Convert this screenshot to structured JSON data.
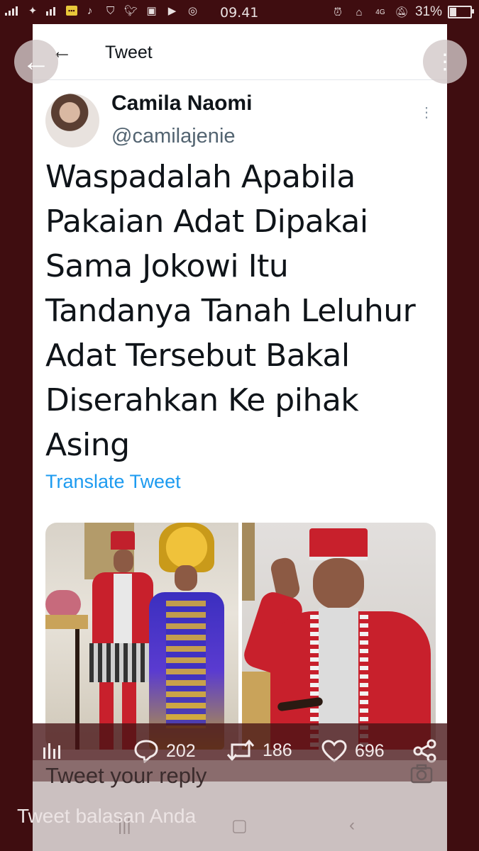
{
  "status_bar": {
    "time": "09.41",
    "battery": "31%",
    "battery_level": 0.31,
    "network": "4G"
  },
  "header": {
    "title": "Tweet"
  },
  "tweet": {
    "author_name": "Camila Naomi",
    "author_handle": "@camilajenie",
    "lines": [
      "Waspadalah Apabila",
      "Pakaian Adat Dipakai",
      "Sama Jokowi Itu",
      "Tandanya Tanah Leluhur",
      "Adat Tersebut Bakal",
      "Diserahkan Ke pihak",
      "Asing"
    ],
    "translate_label": "Translate Tweet"
  },
  "actions": {
    "replies": "202",
    "retweets": "186",
    "likes": "696"
  },
  "reply_box": {
    "placeholder": "Tweet your reply"
  },
  "overlay": {
    "label": "Tweet balasan Anda"
  },
  "colors": {
    "accent": "#1d9bf0",
    "frame": "#3f0d10",
    "overlay": "#461214"
  }
}
